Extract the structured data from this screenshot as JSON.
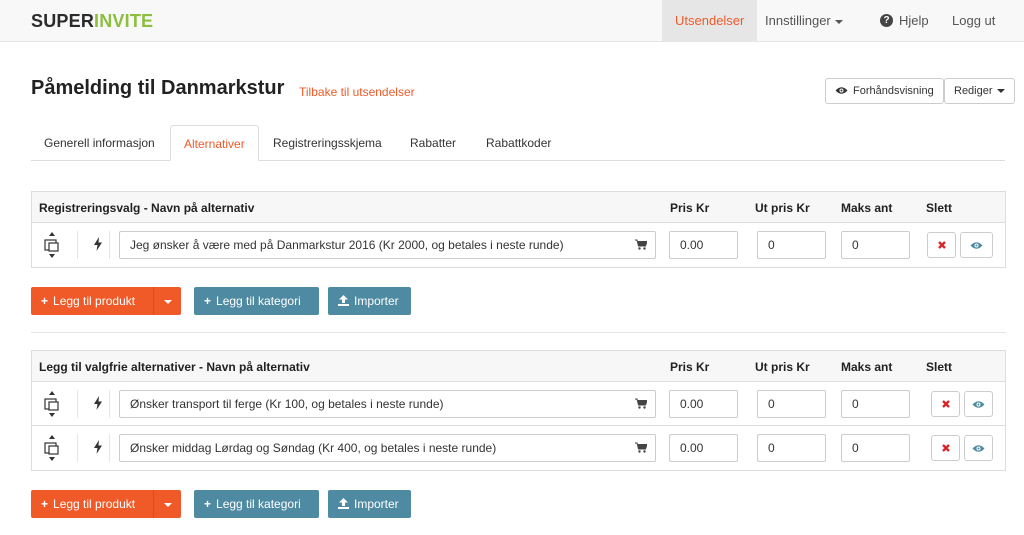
{
  "brand": {
    "part1": "SUPER",
    "part2": "INVITE"
  },
  "nav": {
    "utsendelser": "Utsendelser",
    "innstillinger": "Innstillinger",
    "hjelp": "Hjelp",
    "logout": "Logg ut"
  },
  "page": {
    "title": "Påmelding til Danmarkstur",
    "back_link": "Tilbake til utsendelser",
    "preview_button": "Forhåndsvisning",
    "edit_button": "Rediger"
  },
  "tabs": [
    "Generell informasjon",
    "Alternativer",
    "Registreringsskjema",
    "Rabatter",
    "Rabattkoder"
  ],
  "active_tab": "Alternativer",
  "registration_panel": {
    "headers": {
      "name": "Registreringsvalg - Navn på alternativ",
      "price": "Pris Kr",
      "out_price": "Ut pris Kr",
      "max": "Maks ant",
      "delete": "Slett"
    },
    "rows": [
      {
        "name": "Jeg ønsker å være med på Danmarkstur 2016 (Kr 2000, og betales i neste runde)",
        "price": "0.00",
        "out_price": "0",
        "max": "0"
      }
    ]
  },
  "optional_panel": {
    "headers": {
      "name": "Legg til valgfrie alternativer - Navn på alternativ",
      "price": "Pris Kr",
      "out_price": "Ut pris Kr",
      "max": "Maks ant",
      "delete": "Slett"
    },
    "rows": [
      {
        "name": "Ønsker transport til ferge (Kr 100, og betales i neste runde)",
        "price": "0.00",
        "out_price": "0",
        "max": "0"
      },
      {
        "name": "Ønsker middag Lørdag og Søndag (Kr 400, og betales i neste runde)",
        "price": "0.00",
        "out_price": "0",
        "max": "0"
      }
    ]
  },
  "actions": {
    "add_product": "Legg til produkt",
    "add_category": "Legg til kategori",
    "import": "Importer"
  },
  "colors": {
    "accent": "#f05a28",
    "brand_green": "#8cbf3f",
    "secondary_button": "#4e8aa1",
    "delete_icon": "#d9262a",
    "view_icon": "#4e8aa1"
  },
  "icons": {
    "row_drag": "drag-handle-icon",
    "row_type": "bolt-icon",
    "name_field": "cart-icon",
    "delete": "remove-icon",
    "view": "eye-icon",
    "import": "upload-icon",
    "help": "question-circle-icon"
  }
}
